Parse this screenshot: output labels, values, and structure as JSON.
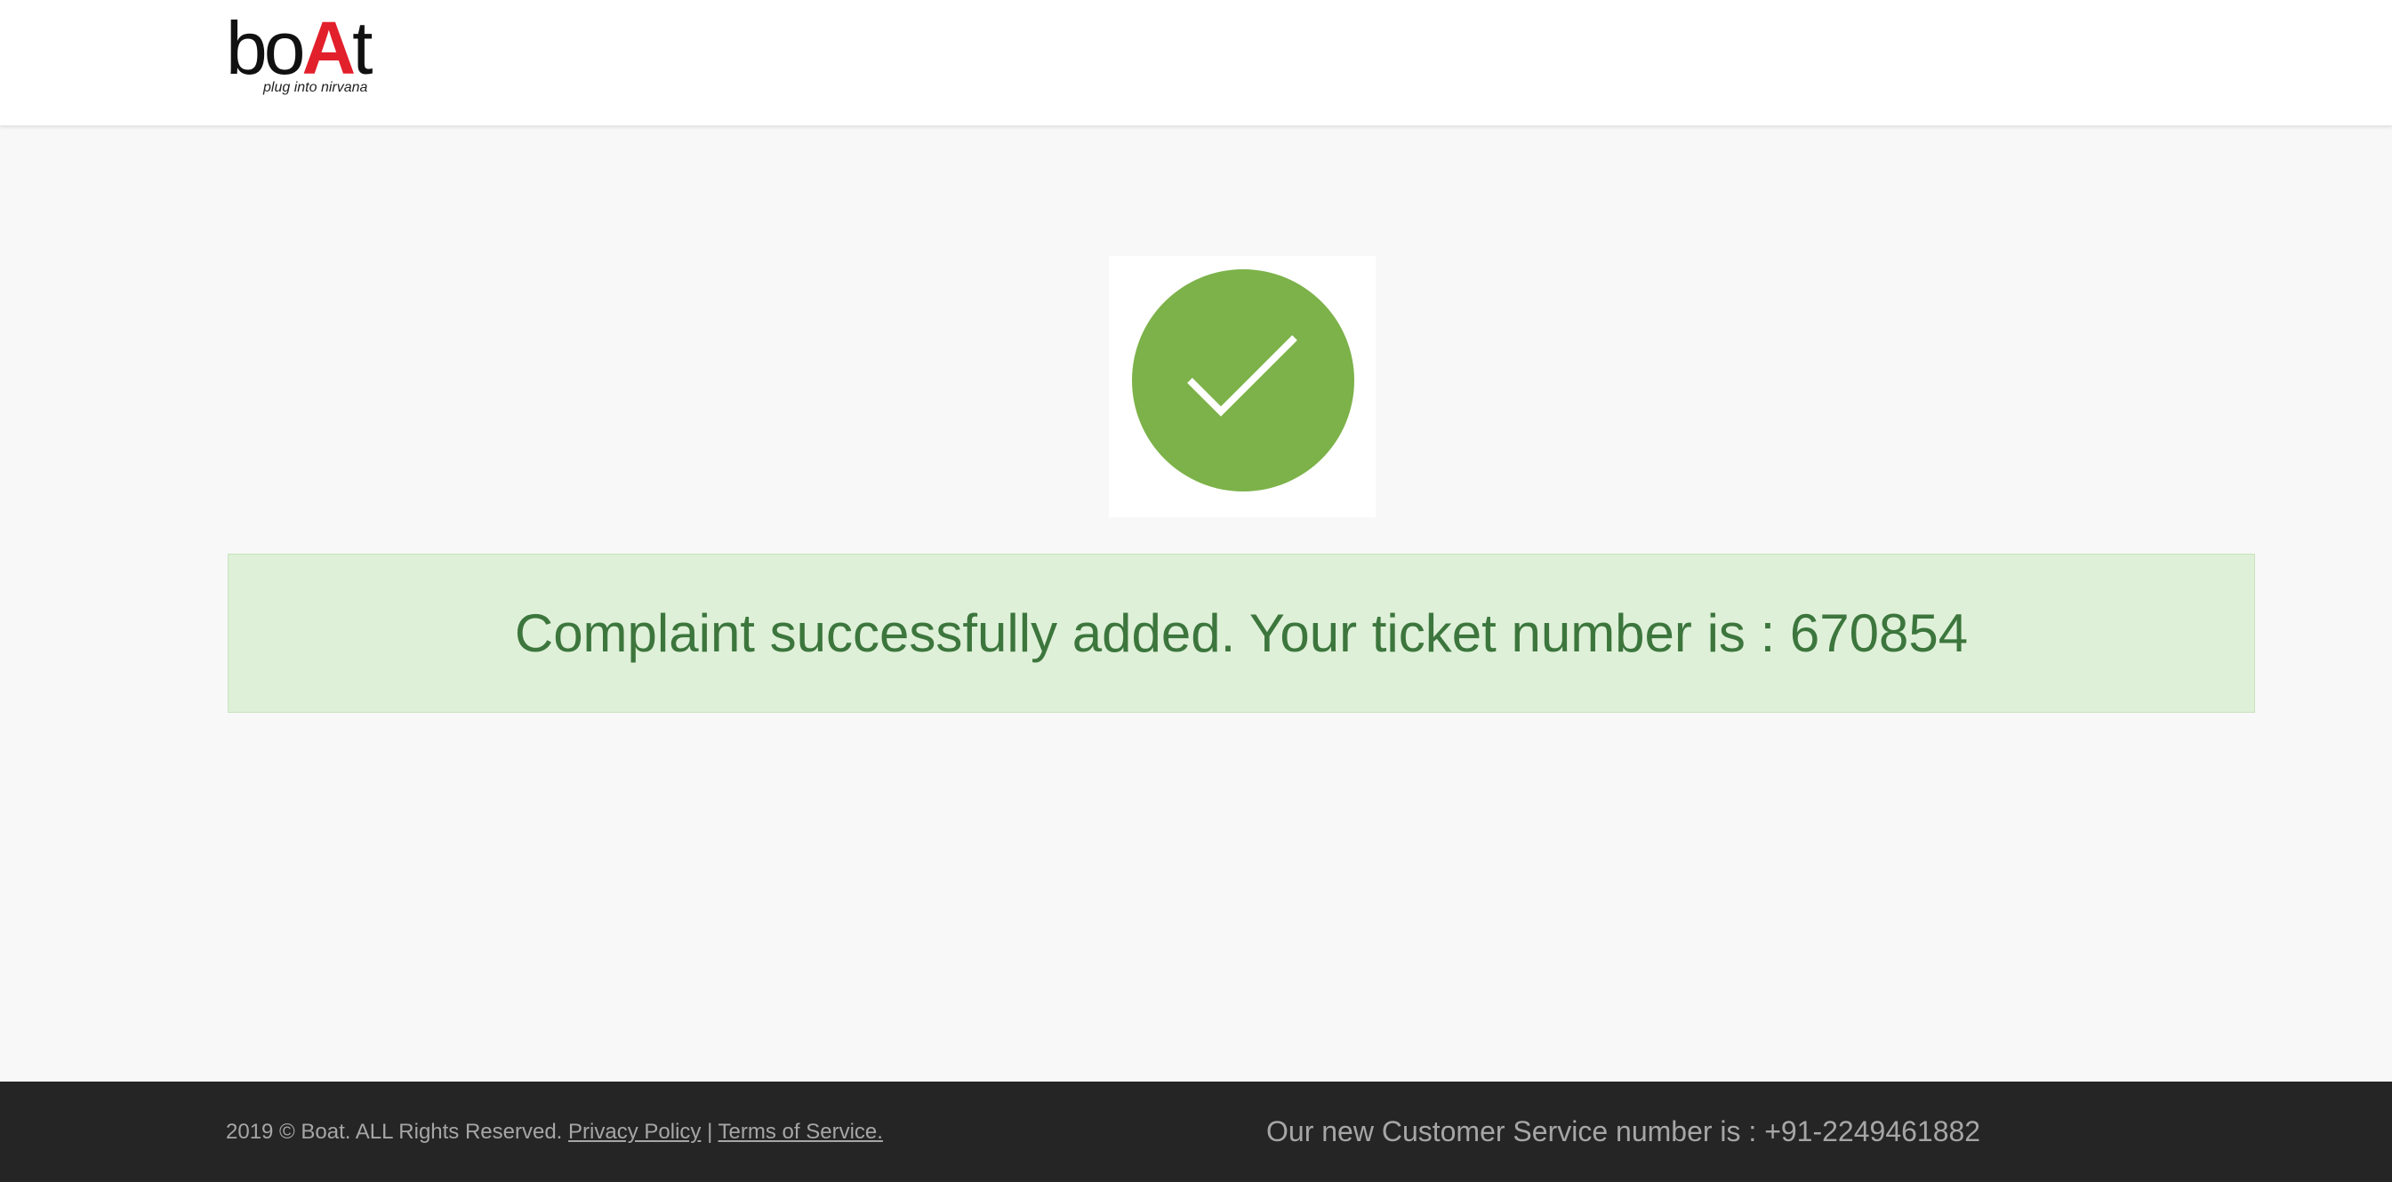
{
  "header": {
    "logo_text_pre": "bo",
    "logo_text_accent": "A",
    "logo_text_post": "t",
    "logo_tagline": "plug into nirvana"
  },
  "success": {
    "icon": "checkmark-circle-icon",
    "icon_color": "#7cb249",
    "message": "Complaint successfully added. Your ticket number is : 670854"
  },
  "footer": {
    "copyright": "2019 © Boat. ALL Rights Reserved.",
    "privacy_link": "Privacy Policy",
    "separator": "|",
    "terms_link": "Terms of Service.",
    "customer_service": "Our new Customer Service number is : +91-2249461882"
  },
  "colors": {
    "brand_red": "#e2202b",
    "success_green": "#7cb249",
    "alert_bg": "#dff0d8",
    "alert_text": "#3c763d",
    "footer_bg": "#252525"
  }
}
